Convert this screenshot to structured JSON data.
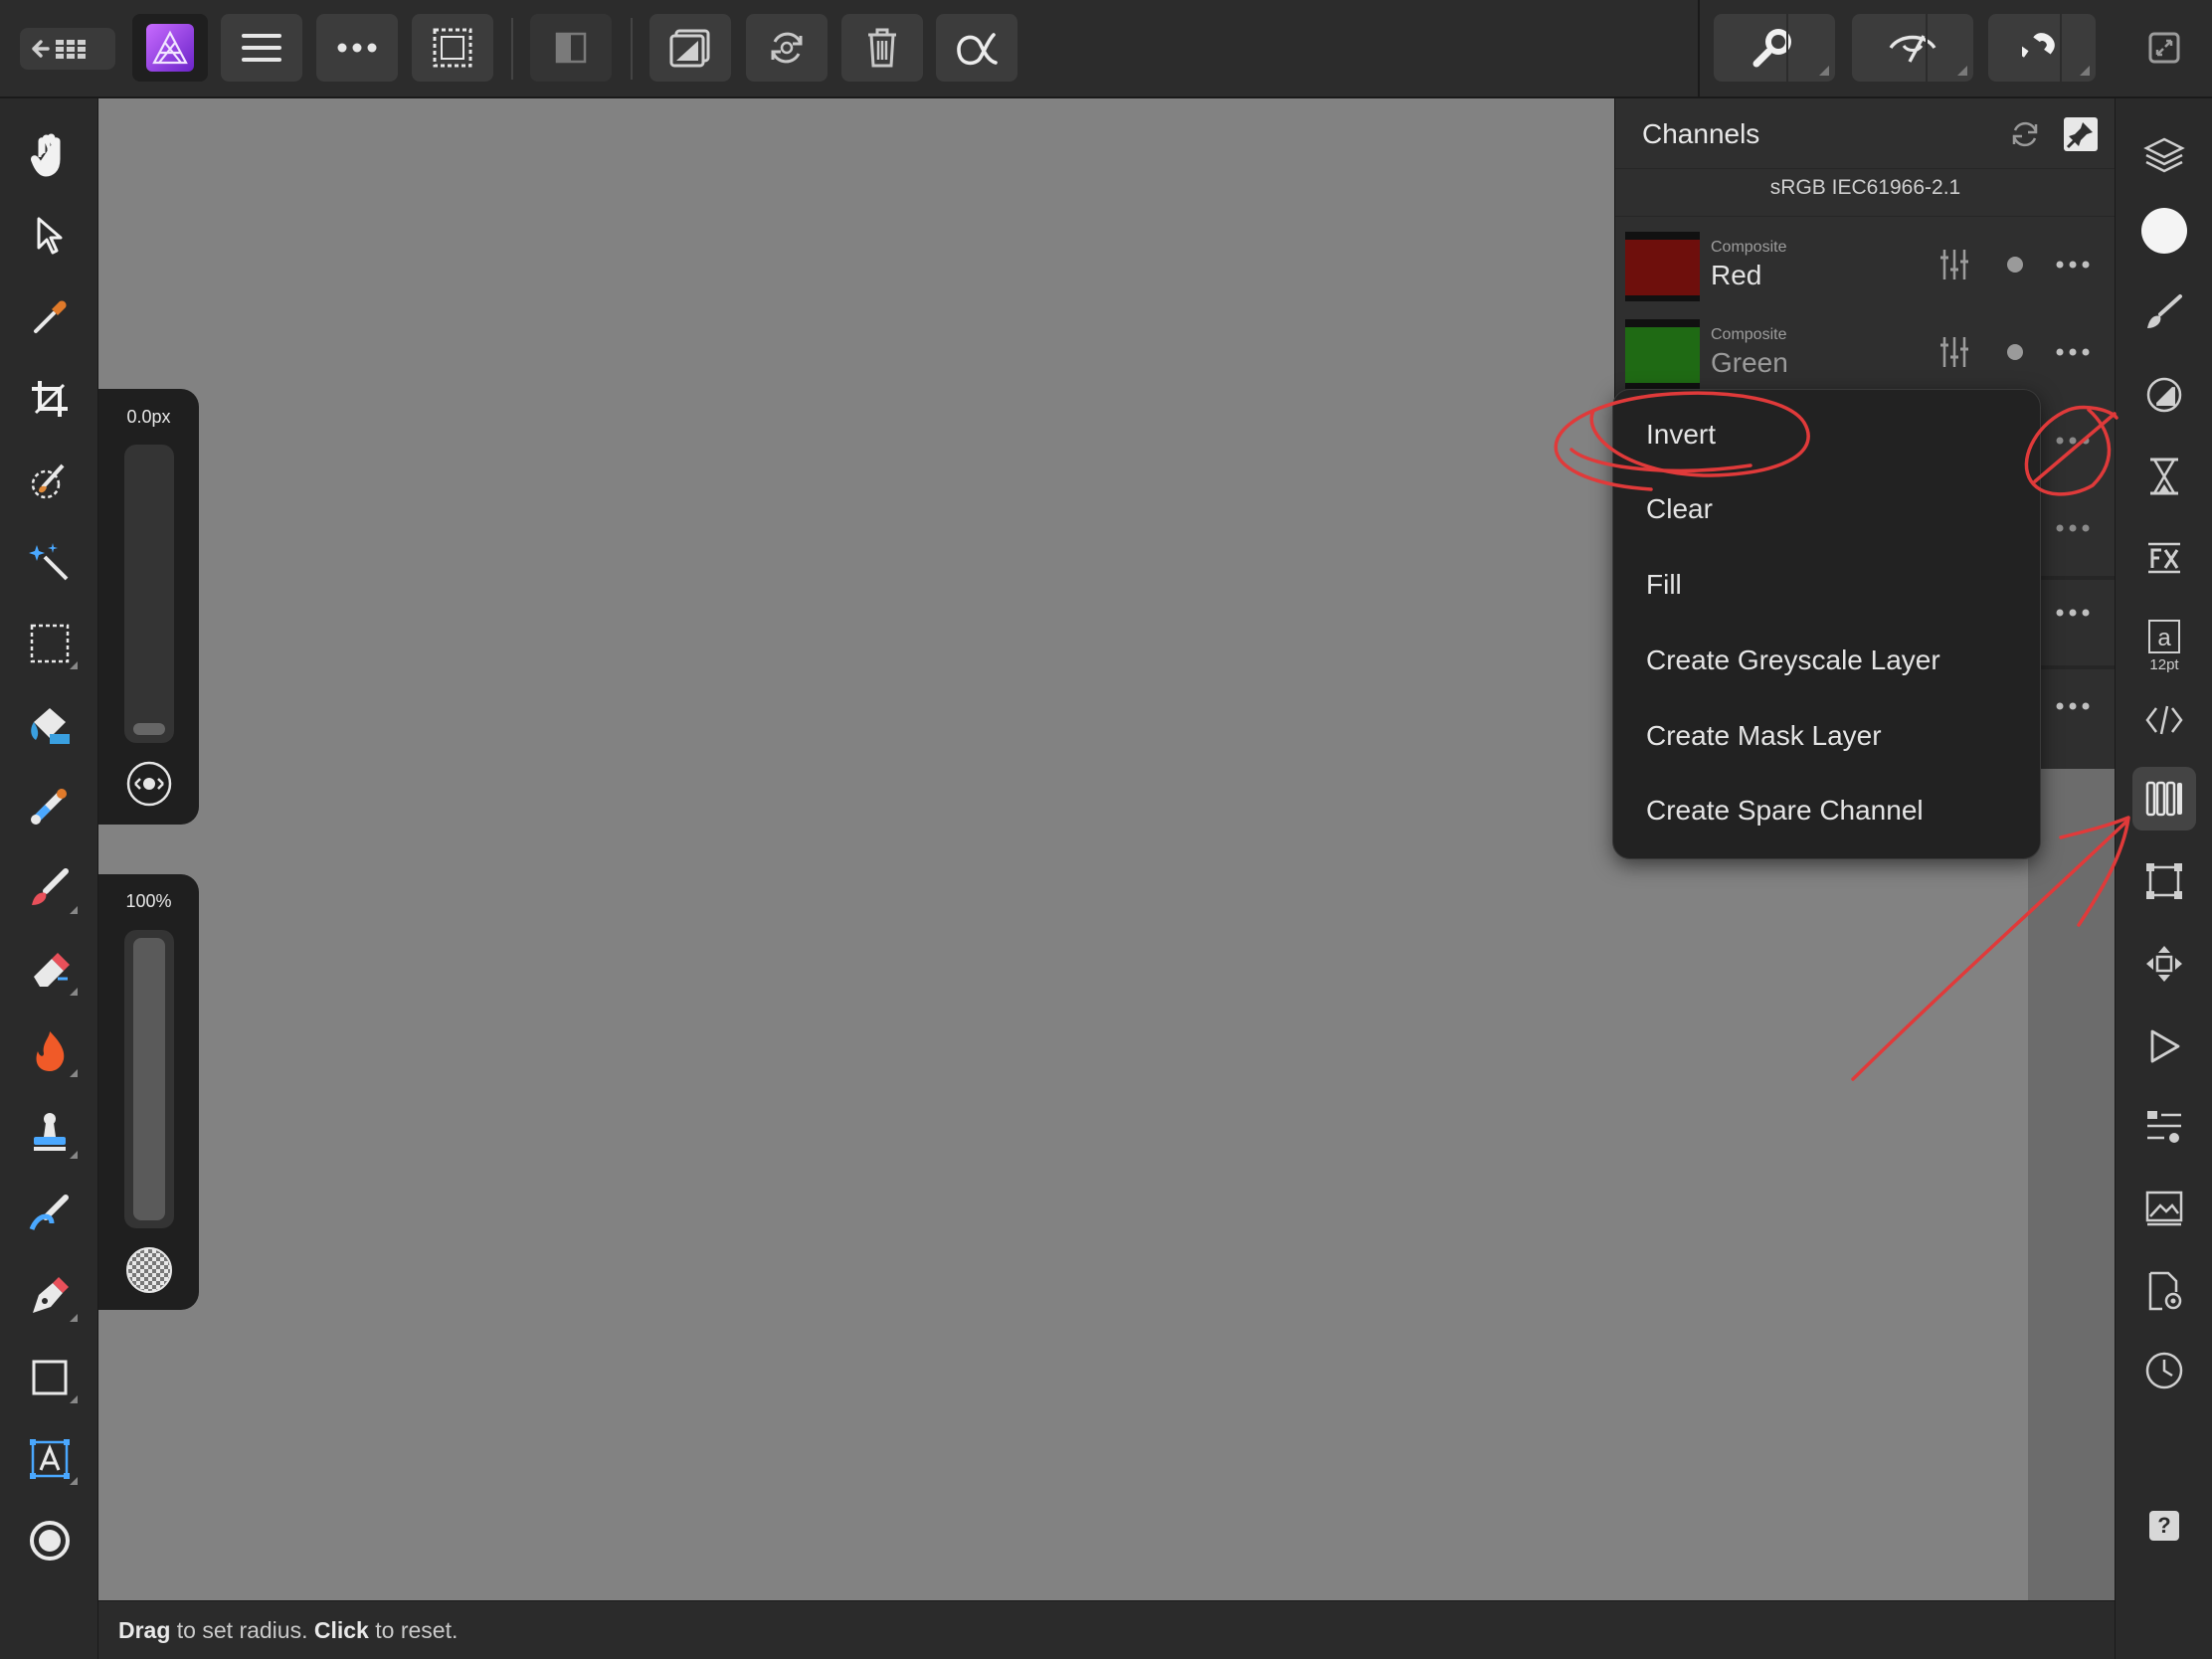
{
  "colors": {
    "accent": "#9b3fe0",
    "canvas": "#828282",
    "annotation": "#e03a3a",
    "red_channel": "#6e0f0c",
    "green_channel": "#1f6a14"
  },
  "toolbar": {
    "back_icon": "back-to-grid-icon",
    "app_icon": "affinity-photo-icon",
    "menu_icon": "menu-icon",
    "more_icon": "more-icon",
    "selection_icon": "selection-icon",
    "quickmask_icon": "quick-mask-icon",
    "persona_icon": "develop-persona-icon",
    "history_icon": "history-icon",
    "trash_icon": "trash-icon",
    "alpha_icon": "alpha-icon",
    "zoom_icon": "zoom-icon",
    "view_icon": "view-mode-icon",
    "snapping_icon": "snapping-icon",
    "fullscreen_icon": "fullscreen-icon"
  },
  "brush": {
    "width_label": "0.0px",
    "width_level": 0.0,
    "opacity_label": "100%",
    "opacity_level": 1.0
  },
  "status": {
    "drag": "Drag",
    "drag_rest": " to set radius. ",
    "click": "Click",
    "click_rest": " to reset."
  },
  "channels": {
    "title": "Channels",
    "profile": "sRGB IEC61966-2.1",
    "rows": [
      {
        "group": "Composite",
        "name": "Red",
        "color": "#6e0f0c"
      },
      {
        "group": "Composite",
        "name": "Green",
        "color": "#1f6a14"
      }
    ]
  },
  "popup_menu": {
    "items": [
      "Invert",
      "Clear",
      "Fill",
      "Create Greyscale Layer",
      "Create Mask Layer",
      "Create Spare Channel"
    ]
  },
  "right_tabs": {
    "text_size": "12pt",
    "help": "?"
  }
}
